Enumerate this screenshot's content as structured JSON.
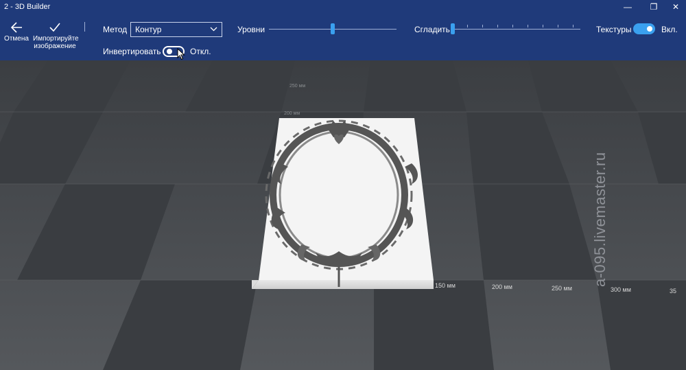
{
  "window": {
    "title": "2 - 3D Builder",
    "controls": {
      "minimize": "—",
      "restore": "❐",
      "close": "✕"
    }
  },
  "toolbar": {
    "back_label": "Отмена",
    "import_label_line1": "Импортируйте",
    "import_label_line2": "изображение",
    "method_label": "Метод",
    "method_value": "Контур",
    "levels_label": "Уровни",
    "levels_value": 0.46,
    "smooth_label": "Сгладить",
    "smooth_value": 0.0,
    "textures_label": "Текстуры",
    "textures_state": "Вкл.",
    "invert_label": "Инвертировать",
    "invert_state": "Откл."
  },
  "viewport": {
    "axis_labels": [
      "150 мм",
      "200 мм",
      "250 мм",
      "300 мм",
      "35"
    ],
    "vertical_labels": [
      "250 мм",
      "200 мм"
    ],
    "watermark": "a-095.livemaster.ru"
  },
  "colors": {
    "accent": "#3aa0ef",
    "toolbar_bg": "#1f3a7a",
    "floor": "#4a4d51"
  }
}
